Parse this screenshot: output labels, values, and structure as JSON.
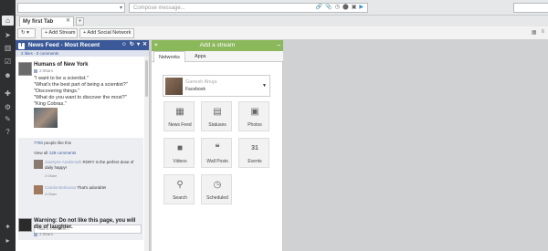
{
  "rail": {
    "icons": [
      "home-icon",
      "send-icon",
      "analytics-icon",
      "assignments-icon",
      "contacts-icon",
      "apps-icon",
      "settings-icon",
      "tools-icon",
      "help-icon",
      "bottom-icon",
      "tab-icon"
    ]
  },
  "compose": {
    "placeholder": "Compose message..."
  },
  "tabs": {
    "current": "My first Tab",
    "close": "✕",
    "add": "+"
  },
  "toolbar": {
    "add_stream": "+ Add Stream",
    "add_social_network": "+ Add Social Network"
  },
  "stream": {
    "title": "News Feed - Most Recent",
    "sub": "2 likes · 0 comments",
    "post1": {
      "author": "Humans of New York",
      "time": "2:05am",
      "body": "\"I want to be a scientist.\"\n\"What's the best part of being a scientist?\"\n\"Discovering things.\"\n\"What do you want to discover the most?\"\n\"King Cobras.\""
    },
    "likes_count": "7760",
    "likes_suffix": " people like this",
    "view_all_prefix": "View all ",
    "view_all_link": "128 comments",
    "comment1": {
      "name": "Jaselyne Anakirnath",
      "text": "RORY is the perfect dose of daily happy!",
      "time": "2:05am"
    },
    "comment2": {
      "name": "Camila Berkovsa",
      "text": "That's adorable!",
      "time": "2:05am"
    },
    "add_comment_placeholder": "Add a comment...",
    "post2": {
      "author": "Warning: Do not like this page, you will die of laughter.",
      "time": "2:05am"
    }
  },
  "add_stream": {
    "title": "Add a stream",
    "tab_networks": "Networks",
    "tab_apps": "Apps",
    "account_name": "Ganesh Ahuja",
    "account_type": "Facebook",
    "buttons": [
      {
        "label": "News Feed",
        "icon": "newsfeed-icon",
        "glyph": "▦"
      },
      {
        "label": "Statuses",
        "icon": "statuses-icon",
        "glyph": "▤"
      },
      {
        "label": "Photos",
        "icon": "photos-icon",
        "glyph": "▣"
      },
      {
        "label": "Videos",
        "icon": "videos-icon",
        "glyph": "■"
      },
      {
        "label": "Wall Posts",
        "icon": "wallposts-icon",
        "glyph": "❝"
      },
      {
        "label": "Events",
        "icon": "events-icon",
        "glyph": "31"
      },
      {
        "label": "Search",
        "icon": "search-icon",
        "glyph": "⚲"
      },
      {
        "label": "Scheduled",
        "icon": "scheduled-icon",
        "glyph": "◷"
      }
    ]
  },
  "colors": {
    "facebook_blue": "#3b5998",
    "add_stream_green": "#8cb85c",
    "rail_dark": "#2d2f31",
    "canvas_gray": "#cfd1d3"
  }
}
